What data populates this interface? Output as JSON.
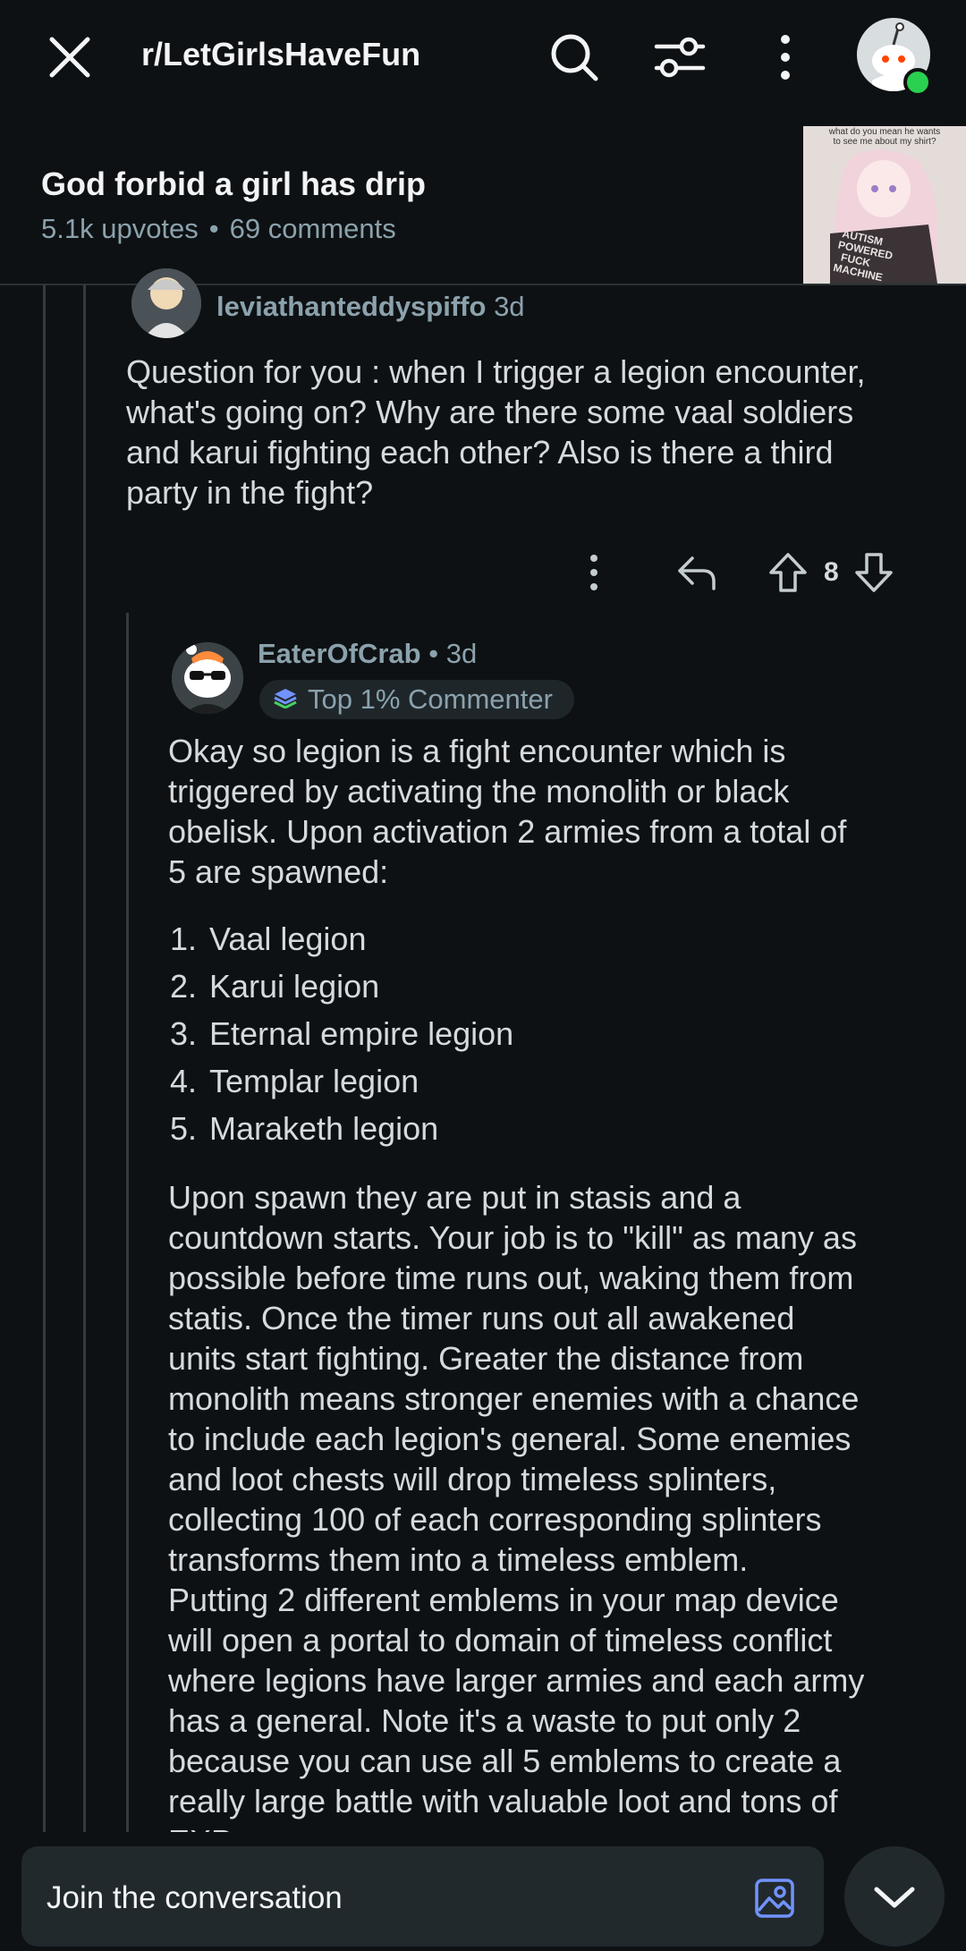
{
  "header": {
    "subreddit": "r/LetGirlsHaveFun",
    "icons": [
      "close-icon",
      "search-icon",
      "filter-icon",
      "more-icon",
      "avatar"
    ]
  },
  "post": {
    "title": "God forbid a girl has drip",
    "upvotes": "5.1k upvotes",
    "comments": "69 comments",
    "thumbnail": {
      "caption_top": "what do you mean he wants to see me about my shirt?",
      "shirt_text": [
        "AUTISM",
        "POWERED",
        "FUCK",
        "MACHINE"
      ]
    }
  },
  "comment1": {
    "username": "leviathanteddyspiffo",
    "time": "3d",
    "lines": [
      "Question for you : when I trigger a legion encounter,",
      "what's going on? Why are there some vaal soldiers",
      "and karui fighting each other? Also is there a third",
      "party in the fight?"
    ],
    "votes": "8"
  },
  "comment2": {
    "username": "EaterOfCrab",
    "time": "• 3d",
    "badge": "Top 1% Commenter",
    "intro_lines": [
      "Okay so legion is a fight encounter which is",
      "triggered by activating the monolith or black",
      "obelisk. Upon activation 2 armies from a total of",
      "5 are spawned:"
    ],
    "list": [
      "Vaal legion",
      "Karui legion",
      "Eternal empire legion",
      "Templar legion",
      "Maraketh legion"
    ],
    "body_lines": [
      "Upon spawn they are put in stasis and a",
      "countdown starts. Your job is to \"kill\" as many as",
      "possible before time runs out, waking them from",
      "statis. Once the timer runs out all awakened",
      "units start fighting. Greater the distance from",
      "monolith means stronger enemies with a chance",
      "to include each legion's general. Some enemies",
      "and loot chests will drop timeless splinters,",
      "collecting 100 of each corresponding splinters",
      "transforms them into a timeless emblem.",
      "Putting 2 different emblems in your map device",
      "will open a portal to domain of timeless conflict",
      "where legions have larger armies and each army",
      "has a general. Note it's a waste to put only 2",
      "because you can use all 5 emblems to create a",
      "really large battle with valuable loot and tons of",
      "EXP"
    ]
  },
  "composer": {
    "placeholder": "Join the conversation"
  },
  "colors": {
    "background": "#0e1113",
    "text": "#d7dadc",
    "meta": "#8ba2ad",
    "online": "#2ad04f",
    "accent_blue": "#7193ff"
  }
}
